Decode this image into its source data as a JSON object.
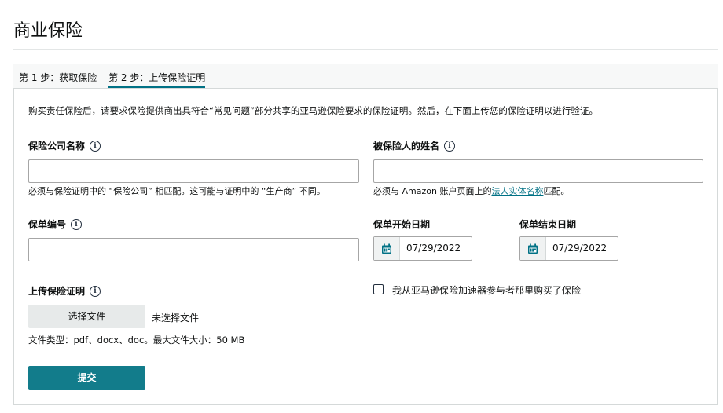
{
  "page": {
    "title": "商业保险"
  },
  "tabs": [
    {
      "label": "第 1 步：获取保险"
    },
    {
      "label": "第 2 步：上传保险证明"
    }
  ],
  "intro": "购买责任保险后，请要求保险提供商出具符合“常见问题”部分共享的亚马逊保险要求的保险证明。然后，在下面上传您的保险证明以进行验证。",
  "fields": {
    "insurer": {
      "label": "保险公司名称",
      "value": "",
      "help": "必须与保险证明中的 “保险公司” 相匹配。这可能与证明中的 “生产商” 不同。"
    },
    "insured": {
      "label": "被保险人的姓名",
      "value": "",
      "help_prefix": "必须与 Amazon 账户页面上的",
      "help_link": "法人实体名称",
      "help_suffix": "匹配。"
    },
    "policy_number": {
      "label": "保单编号",
      "value": ""
    },
    "start_date": {
      "label": "保单开始日期",
      "value": "07/29/2022"
    },
    "end_date": {
      "label": "保单结束日期",
      "value": "07/29/2022"
    },
    "upload": {
      "label": "上传保险证明",
      "button": "选择文件",
      "no_file": "未选择文件",
      "file_types": "文件类型：pdf、docx、doc。最大文件大小：50 MB"
    },
    "accelerator_checkbox": {
      "label": "我从亚马逊保险加速器参与者那里购买了保险",
      "checked": false
    }
  },
  "submit": {
    "label": "提交"
  },
  "icons": {
    "info": "info-icon",
    "calendar": "calendar-icon"
  },
  "colors": {
    "accent": "#007185",
    "submit_bg": "#127c8b"
  }
}
